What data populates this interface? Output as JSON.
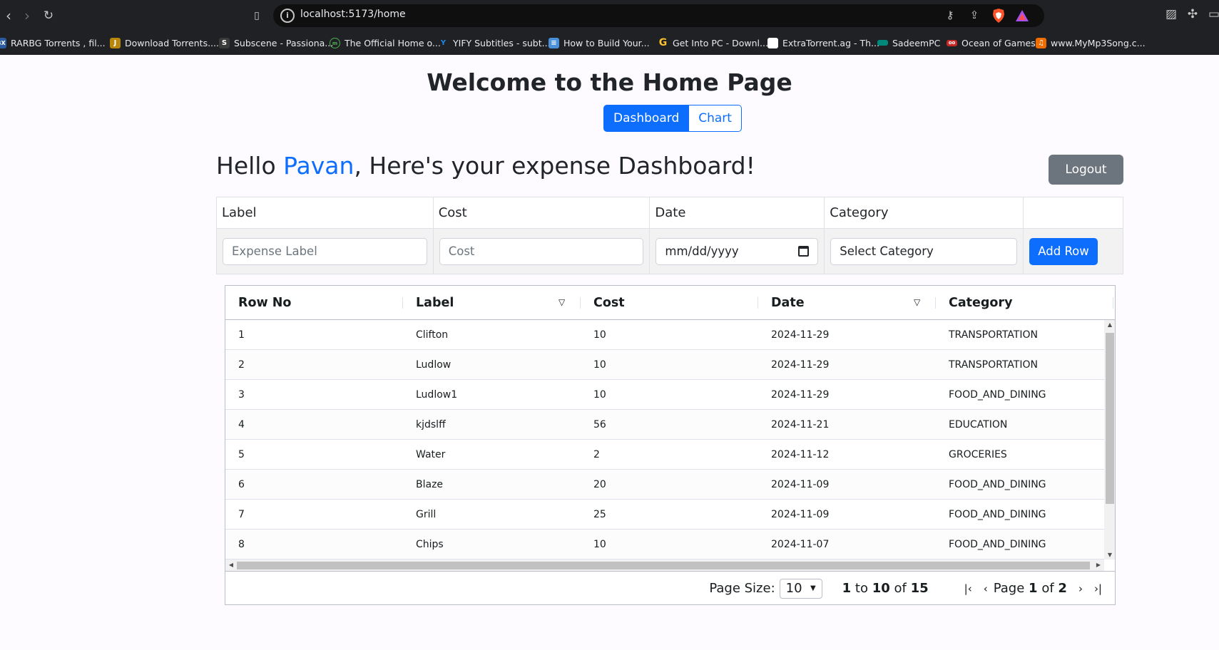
{
  "browser": {
    "url": "localhost:5173/home",
    "bookmarks": [
      {
        "label": "RARBG Torrents , fil...",
        "icon": "rarbg-icon",
        "color": "#2c5aa0"
      },
      {
        "label": "Download Torrents....",
        "icon": "torrent-icon",
        "color": "#b8860b"
      },
      {
        "label": "Subscene - Passiona...",
        "icon": "subscene-icon",
        "color": "#3a3a3a"
      },
      {
        "label": "The Official Home o...",
        "icon": "official-home-icon",
        "color": "#4caf50"
      },
      {
        "label": "YIFY Subtitles - subt...",
        "icon": "yify-icon",
        "color": "#1e88e5"
      },
      {
        "label": "How to Build Your...",
        "icon": "doc-icon",
        "color": "#4a90d9"
      },
      {
        "label": "Get Into PC - Downl...",
        "icon": "getintopc-icon",
        "color": "#fbc02d"
      },
      {
        "label": "ExtraTorrent.ag - Th...",
        "icon": "page-icon",
        "color": "#ffffff"
      },
      {
        "label": "SadeemPC",
        "icon": "sadeempc-icon",
        "color": "#00897b"
      },
      {
        "label": "Ocean of Games",
        "icon": "oceanofgames-icon",
        "color": "#c62828"
      },
      {
        "label": "www.MyMp3Song.c...",
        "icon": "mp3-icon",
        "color": "#ef6c00"
      }
    ]
  },
  "page": {
    "title": "Welcome to the Home Page",
    "tabs": [
      "Dashboard",
      "Chart"
    ],
    "greeting_prefix": "Hello ",
    "user_name": "Pavan",
    "greeting_suffix": ", Here's your expense Dashboard!",
    "logout_label": "Logout"
  },
  "form": {
    "headers": [
      "Label",
      "Cost",
      "Date",
      "Category"
    ],
    "label_placeholder": "Expense Label",
    "cost_placeholder": "Cost",
    "date_placeholder": "mm/dd/yyyy",
    "category_placeholder": "Select Category",
    "add_button": "Add Row"
  },
  "grid": {
    "columns": [
      "Row No",
      "Label",
      "Cost",
      "Date",
      "Category"
    ],
    "rows": [
      [
        "1",
        "Clifton",
        "10",
        "2024-11-29",
        "TRANSPORTATION"
      ],
      [
        "2",
        "Ludlow",
        "10",
        "2024-11-29",
        "TRANSPORTATION"
      ],
      [
        "3",
        "Ludlow1",
        "10",
        "2024-11-29",
        "FOOD_AND_DINING"
      ],
      [
        "4",
        "kjdslff",
        "56",
        "2024-11-21",
        "EDUCATION"
      ],
      [
        "5",
        "Water",
        "2",
        "2024-11-12",
        "GROCERIES"
      ],
      [
        "6",
        "Blaze",
        "20",
        "2024-11-09",
        "FOOD_AND_DINING"
      ],
      [
        "7",
        "Grill",
        "25",
        "2024-11-09",
        "FOOD_AND_DINING"
      ],
      [
        "8",
        "Chips",
        "10",
        "2024-11-07",
        "FOOD_AND_DINING"
      ]
    ],
    "page_size_label": "Page Size:",
    "page_size": "10",
    "range_from": "1",
    "range_to": "10",
    "range_of": "of",
    "range_total": "15",
    "range_sep": "to",
    "page_label": "Page",
    "page_current": "1",
    "page_total": "2"
  }
}
